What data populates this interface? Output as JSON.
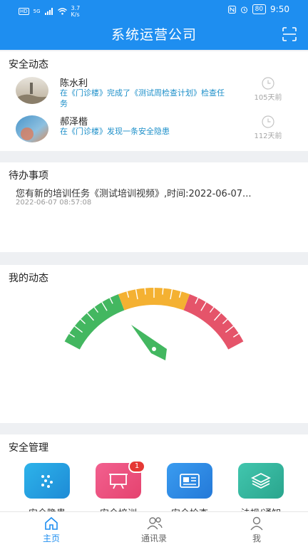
{
  "status_bar": {
    "net_left": "HD",
    "signal_label": "5G",
    "speed_value": "3.7",
    "speed_unit": "K/s",
    "battery": "80",
    "time": "9:50"
  },
  "header": {
    "title": "系统运营公司",
    "scan_icon": "scan-icon"
  },
  "safety_news": {
    "title": "安全动态",
    "items": [
      {
        "name": "陈水利",
        "text": "在《门诊楼》完成了《测试周检查计划》检查任务",
        "time": "105天前"
      },
      {
        "name": "郝泽楷",
        "text": "在《门诊楼》发现一条安全隐患",
        "time": "112天前"
      }
    ]
  },
  "todo": {
    "title": "待办事项",
    "items": [
      {
        "text": "您有新的培训任务《测试培训视频》,时间:2022-06-07...",
        "date": "2022-06-07 08:57:08"
      }
    ]
  },
  "my_dynamic": {
    "title": "我的动态",
    "gauge_colors": [
      "#43b760",
      "#f4b132",
      "#e5546a"
    ]
  },
  "management": {
    "title": "安全管理",
    "items": [
      {
        "label": "安全隐患",
        "icon": "dots-icon",
        "color": "#1fa1e0"
      },
      {
        "label": "安全培训",
        "icon": "presentation-icon",
        "color": "#ea4f7e",
        "badge": "1"
      },
      {
        "label": "安全检查",
        "icon": "id-card-icon",
        "color": "#2d8be3"
      },
      {
        "label": "法规/通知",
        "icon": "layers-icon",
        "color": "#36b8a0"
      }
    ]
  },
  "tabbar": {
    "items": [
      {
        "label": "主页",
        "icon": "home-icon",
        "active": true
      },
      {
        "label": "通讯录",
        "icon": "contacts-icon",
        "active": false
      },
      {
        "label": "我",
        "icon": "user-icon",
        "active": false
      }
    ],
    "active_color": "#1e8ef0",
    "inactive_color": "#666666"
  }
}
